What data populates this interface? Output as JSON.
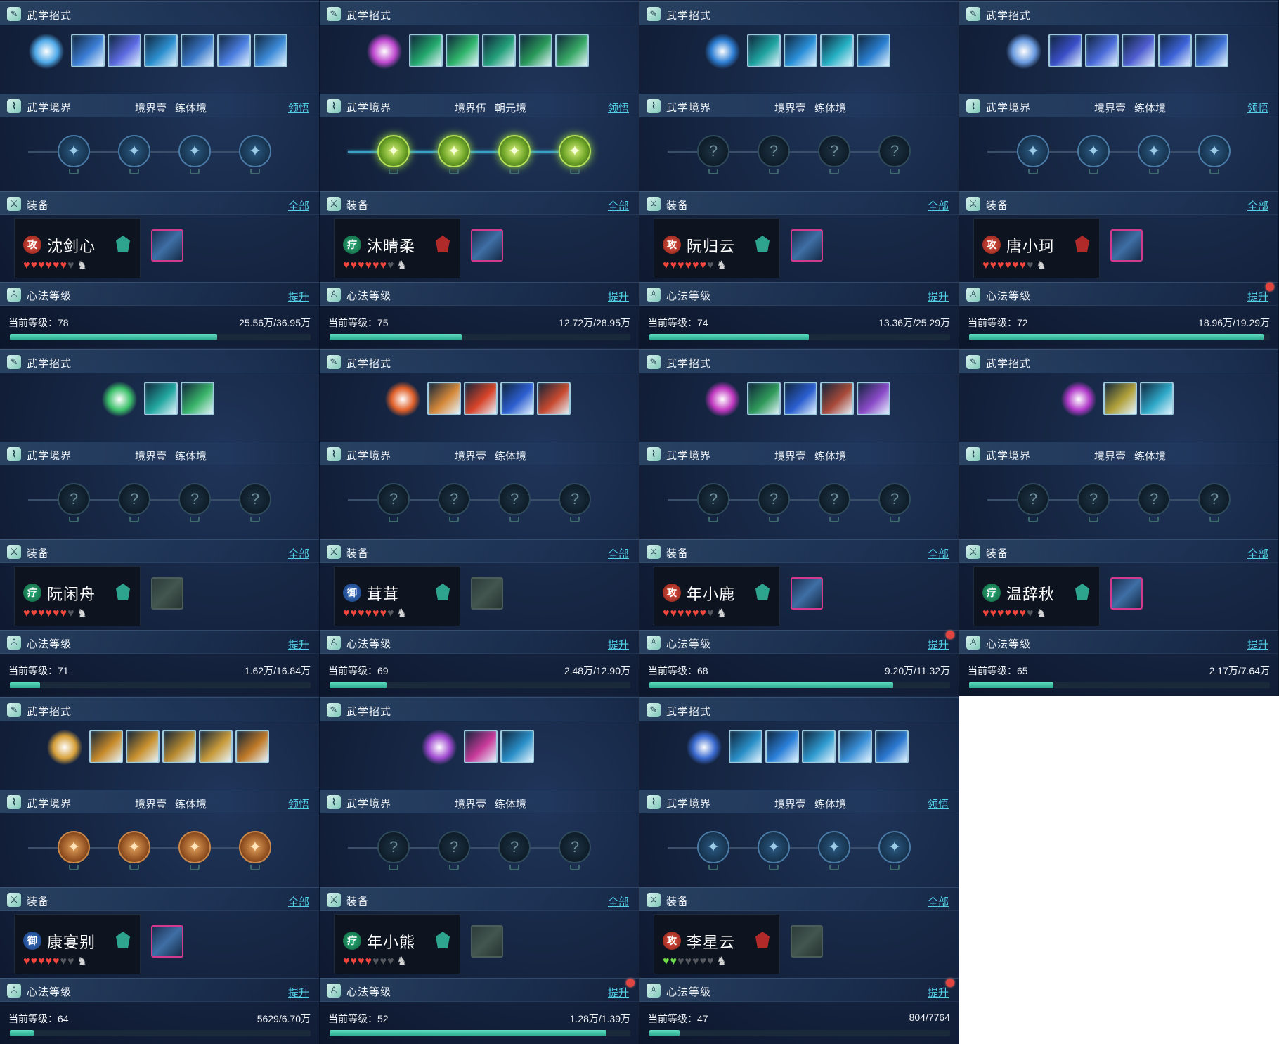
{
  "labels": {
    "skills": "武学招式",
    "realm": "武学境界",
    "equip": "装备",
    "equip_all": "全部",
    "heart_method": "心法等级",
    "upgrade": "提升",
    "level_prefix": "当前等级："
  },
  "colors": {
    "accent_link": "#53d0e8",
    "progress": "#2aa58d",
    "heart": "#f0463c",
    "reddot": "#e2453f"
  },
  "panels": [
    {
      "name": "沈剑心",
      "role": "攻",
      "role_type": "atk",
      "class_color": "#2ea38d",
      "realm_level": "境界壹",
      "realm_stage": "练体境",
      "realm_link": "领悟",
      "realm_state": "blue",
      "skill_colors": [
        "#3c7fd6",
        "#5b6ae0",
        "#2d8fd0",
        "#3a78c9",
        "#4b7ee0",
        "#3d8ad8"
      ],
      "main_skill_color": "#4fa9e8",
      "hearts_full": 6,
      "hearts_empty": 1,
      "hearts_green": 0,
      "equip_filled": true,
      "level": "78",
      "exp": "25.56万/36.95万",
      "progress": 0.69,
      "reddot": false
    },
    {
      "name": "沐晴柔",
      "role": "疗",
      "role_type": "heal",
      "class_color": "#b02a2a",
      "realm_level": "境界伍",
      "realm_stage": "朝元境",
      "realm_link": "领悟",
      "realm_state": "lit",
      "skill_colors": [
        "#23a86c",
        "#2fb46b",
        "#24a07a",
        "#2a9a5a",
        "#37a865"
      ],
      "main_skill_color": "#c04ad0",
      "hearts_full": 6,
      "hearts_empty": 1,
      "hearts_green": 0,
      "equip_filled": true,
      "level": "75",
      "exp": "12.72万/28.95万",
      "progress": 0.44,
      "reddot": false
    },
    {
      "name": "阮归云",
      "role": "攻",
      "role_type": "atk",
      "class_color": "#2ea38d",
      "realm_level": "境界壹",
      "realm_stage": "练体境",
      "realm_link": "",
      "realm_state": "dark",
      "skill_colors": [
        "#1fa3a0",
        "#2a8fd8",
        "#26b0c4",
        "#2a7fd0"
      ],
      "main_skill_color": "#2e7fd4",
      "hearts_full": 6,
      "hearts_empty": 1,
      "hearts_green": 0,
      "equip_filled": true,
      "level": "74",
      "exp": "13.36万/25.29万",
      "progress": 0.53,
      "reddot": false
    },
    {
      "name": "唐小珂",
      "role": "攻",
      "role_type": "atk",
      "class_color": "#b02a2a",
      "realm_level": "境界壹",
      "realm_stage": "练体境",
      "realm_link": "领悟",
      "realm_state": "blue",
      "skill_colors": [
        "#3a4fc8",
        "#4a6ad8",
        "#4f5ed0",
        "#3d63d8",
        "#3f72d6"
      ],
      "main_skill_color": "#6b9be0",
      "hearts_full": 6,
      "hearts_empty": 1,
      "hearts_green": 0,
      "equip_filled": true,
      "level": "72",
      "exp": "18.96万/19.29万",
      "progress": 0.98,
      "reddot": true
    },
    {
      "name": "阮闲舟",
      "role": "疗",
      "role_type": "heal",
      "class_color": "#2ea38d",
      "realm_level": "境界壹",
      "realm_stage": "练体境",
      "realm_link": "",
      "realm_state": "dark",
      "skill_colors": [
        "#23a7a0",
        "#3ab46a"
      ],
      "main_skill_color": "#3cc06a",
      "hearts_full": 6,
      "hearts_empty": 1,
      "hearts_green": 0,
      "equip_filled": false,
      "level": "71",
      "exp": "1.62万/16.84万",
      "progress": 0.1,
      "reddot": false
    },
    {
      "name": "茸茸",
      "role": "御",
      "role_type": "def",
      "class_color": "#2ea38d",
      "realm_level": "境界壹",
      "realm_stage": "练体境",
      "realm_link": "",
      "realm_state": "dark",
      "skill_colors": [
        "#d6893a",
        "#d8442a",
        "#2d5fd0",
        "#c84a30"
      ],
      "main_skill_color": "#e0602a",
      "hearts_full": 6,
      "hearts_empty": 1,
      "hearts_green": 0,
      "equip_filled": false,
      "level": "69",
      "exp": "2.48万/12.90万",
      "progress": 0.19,
      "reddot": false
    },
    {
      "name": "年小鹿",
      "role": "攻",
      "role_type": "atk",
      "class_color": "#2ea38d",
      "realm_level": "境界壹",
      "realm_stage": "练体境",
      "realm_link": "",
      "realm_state": "dark",
      "skill_colors": [
        "#2f9a5a",
        "#2b5fd0",
        "#a84a3a",
        "#8a4ac8"
      ],
      "main_skill_color": "#c038c0",
      "hearts_full": 6,
      "hearts_empty": 1,
      "hearts_green": 0,
      "equip_filled": true,
      "level": "68",
      "exp": "9.20万/11.32万",
      "progress": 0.81,
      "reddot": true
    },
    {
      "name": "温辞秋",
      "role": "疗",
      "role_type": "heal",
      "class_color": "#2ea38d",
      "realm_level": "境界壹",
      "realm_stage": "练体境",
      "realm_link": "",
      "realm_state": "dark",
      "skill_colors": [
        "#b0a03a",
        "#2fa8c8"
      ],
      "main_skill_color": "#b03ac8",
      "hearts_full": 6,
      "hearts_empty": 1,
      "hearts_green": 0,
      "equip_filled": true,
      "level": "65",
      "exp": "2.17万/7.64万",
      "progress": 0.28,
      "reddot": false
    },
    {
      "name": "康宴别",
      "role": "御",
      "role_type": "def",
      "class_color": "#2ea38d",
      "realm_level": "境界壹",
      "realm_stage": "练体境",
      "realm_link": "领悟",
      "realm_state": "gold",
      "skill_colors": [
        "#c88a2a",
        "#c9912e",
        "#b88a30",
        "#c89a3a",
        "#c07a28"
      ],
      "main_skill_color": "#d6a03a",
      "hearts_full": 5,
      "hearts_empty": 2,
      "hearts_green": 0,
      "equip_filled": true,
      "level": "64",
      "exp": "5629/6.70万",
      "progress": 0.08,
      "reddot": false
    },
    {
      "name": "年小熊",
      "role": "疗",
      "role_type": "heal",
      "class_color": "#2ea38d",
      "realm_level": "境界壹",
      "realm_stage": "练体境",
      "realm_link": "",
      "realm_state": "dark",
      "skill_colors": [
        "#c83a9a",
        "#2a8fc8"
      ],
      "main_skill_color": "#a04ad0",
      "hearts_full": 4,
      "hearts_empty": 3,
      "hearts_green": 0,
      "equip_filled": false,
      "level": "52",
      "exp": "1.28万/1.39万",
      "progress": 0.92,
      "reddot": true
    },
    {
      "name": "李星云",
      "role": "攻",
      "role_type": "atk",
      "class_color": "#b02a2a",
      "realm_level": "境界壹",
      "realm_stage": "练体境",
      "realm_link": "领悟",
      "realm_state": "blue",
      "skill_colors": [
        "#2a8fc8",
        "#2a7fd8",
        "#2f9ad0",
        "#3a8fd6",
        "#2b78d0"
      ],
      "main_skill_color": "#3a6ad0",
      "hearts_full": 0,
      "hearts_empty": 5,
      "hearts_green": 2,
      "equip_filled": false,
      "level": "47",
      "exp": "804/7764",
      "progress": 0.1,
      "reddot": true
    }
  ]
}
